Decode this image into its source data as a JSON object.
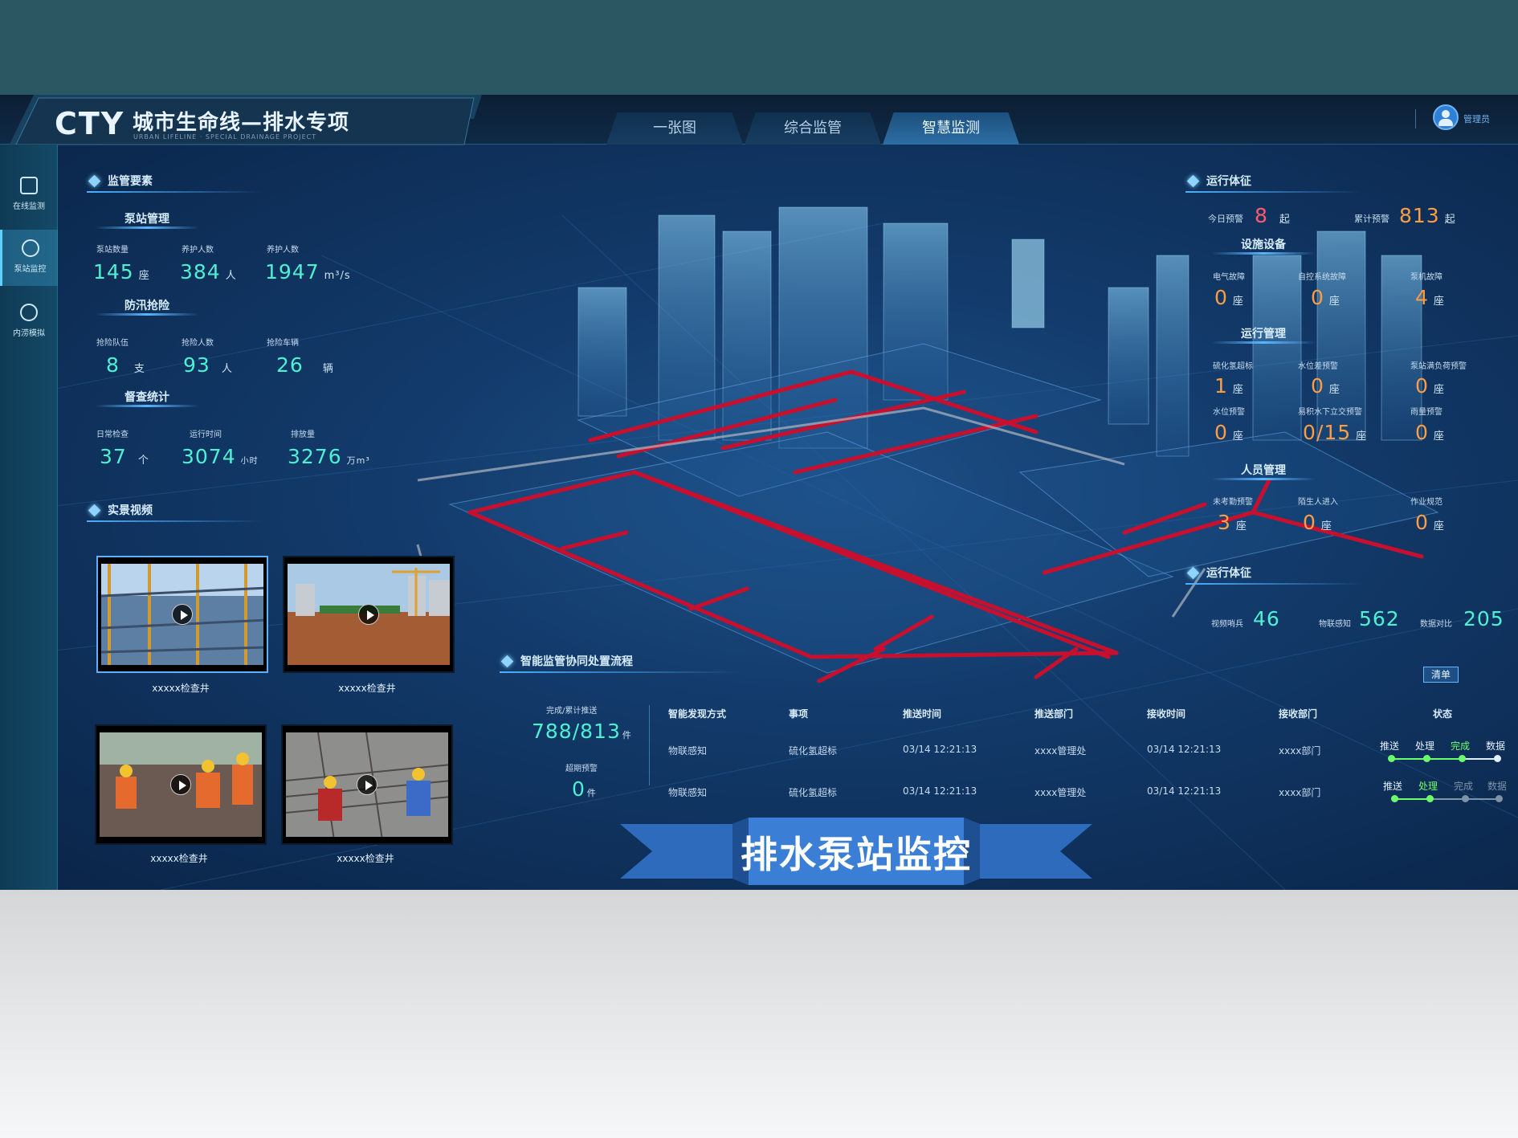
{
  "header": {
    "logo": "CTY",
    "title": "城市生命线—排水专项",
    "subtitle": "URBAN LIFELINE · SPECIAL DRAINAGE PROJECT",
    "tabs": [
      {
        "label": "一张图",
        "active": false
      },
      {
        "label": "综合监管",
        "active": false
      },
      {
        "label": "智慧监测",
        "active": true
      }
    ],
    "user": "管理员"
  },
  "sidebar": {
    "items": [
      {
        "label": "在线监测",
        "icon": "chart-monitor-icon",
        "active": false
      },
      {
        "label": "泵站监控",
        "icon": "camera-icon",
        "active": true
      },
      {
        "label": "内涝模拟",
        "icon": "flood-icon",
        "active": false
      }
    ]
  },
  "left_panel": {
    "title": "监管要素",
    "pump_station": {
      "title": "泵站管理",
      "kpis": [
        {
          "label": "泵站数量",
          "value": "145",
          "unit": "座"
        },
        {
          "label": "养护人数",
          "value": "384",
          "unit": "人"
        },
        {
          "label": "养护人数",
          "value": "1947",
          "unit": "m³/s"
        }
      ]
    },
    "flood": {
      "title": "防汛抢险",
      "kpis": [
        {
          "label": "抢险队伍",
          "value": "8",
          "unit": "支"
        },
        {
          "label": "抢险人数",
          "value": "93",
          "unit": "人"
        },
        {
          "label": "抢险车辆",
          "value": "26",
          "unit": "辆"
        }
      ]
    },
    "inspection": {
      "title": "督查统计",
      "kpis": [
        {
          "label": "日常检查",
          "value": "37",
          "unit": "个"
        },
        {
          "label": "运行时间",
          "value": "3074",
          "unit": "小时"
        },
        {
          "label": "排放量",
          "value": "3276",
          "unit": "万m³"
        }
      ]
    },
    "video_title": "实景视频",
    "videos": [
      {
        "caption": "xxxxx检查井"
      },
      {
        "caption": "xxxxx检查井"
      },
      {
        "caption": "xxxxx检查井"
      },
      {
        "caption": "xxxxx检查井"
      }
    ]
  },
  "right_panel": {
    "title": "运行体征",
    "today_label": "今日预警",
    "today_value": "8",
    "today_unit": "起",
    "total_label": "累计预警",
    "total_value": "813",
    "total_unit": "起",
    "equipment": {
      "title": "设施设备",
      "kpis": [
        {
          "label": "电气故障",
          "value": "0",
          "unit": "座"
        },
        {
          "label": "自控系统故障",
          "value": "0",
          "unit": "座"
        },
        {
          "label": "泵机故障",
          "value": "4",
          "unit": "座"
        }
      ]
    },
    "operation": {
      "title": "运行管理",
      "kpis": [
        {
          "label": "硫化氢超标",
          "value": "1",
          "unit": "座"
        },
        {
          "label": "水位差预警",
          "value": "0",
          "unit": "座"
        },
        {
          "label": "泵站满负荷预警",
          "value": "0",
          "unit": "座"
        },
        {
          "label": "水位预警",
          "value": "0",
          "unit": "座"
        },
        {
          "label": "易积水下立交预警",
          "value": "0/15",
          "unit": "座"
        },
        {
          "label": "雨量预警",
          "value": "0",
          "unit": "座"
        }
      ]
    },
    "personnel": {
      "title": "人员管理",
      "kpis": [
        {
          "label": "未考勤预警",
          "value": "3",
          "unit": "座"
        },
        {
          "label": "陌生人进入",
          "value": "0",
          "unit": "座"
        },
        {
          "label": "作业规范",
          "value": "0",
          "unit": "座"
        }
      ]
    },
    "sign2_title": "运行体征",
    "sign2": [
      {
        "label": "视频哨兵",
        "value": "46"
      },
      {
        "label": "物联感知",
        "value": "562"
      },
      {
        "label": "数据对比",
        "value": "205"
      }
    ]
  },
  "flow": {
    "title": "智能监管协同处置流程",
    "clear": "清单",
    "completed_label": "完成/累计推送",
    "completed_value": "788/813",
    "completed_unit": "件",
    "overdue_label": "超期预警",
    "overdue_value": "0",
    "overdue_unit": "件",
    "headers": [
      "智能发现方式",
      "事项",
      "推送时间",
      "推送部门",
      "接收时间",
      "接收部门",
      "状态"
    ],
    "rows": [
      {
        "method": "物联感知",
        "item": "硫化氢超标",
        "push_time": "03/14  12:21:13",
        "push_dept": "xxxx管理处",
        "recv_time": "03/14  12:21:13",
        "recv_dept": "xxxx部门",
        "steps": [
          "推送",
          "处理",
          "完成",
          "数据"
        ],
        "current": 2
      },
      {
        "method": "物联感知",
        "item": "硫化氢超标",
        "push_time": "03/14  12:21:13",
        "push_dept": "xxxx管理处",
        "recv_time": "03/14  12:21:13",
        "recv_dept": "xxxx部门",
        "steps": [
          "推送",
          "处理",
          "完成",
          "数据"
        ],
        "current": 1
      }
    ]
  },
  "banner": "排水泵站监控",
  "colors": {
    "accent": "#4ef0d2",
    "warning": "#ff9d43",
    "alert": "#ff5a6e",
    "pipe": "#c8102e"
  }
}
